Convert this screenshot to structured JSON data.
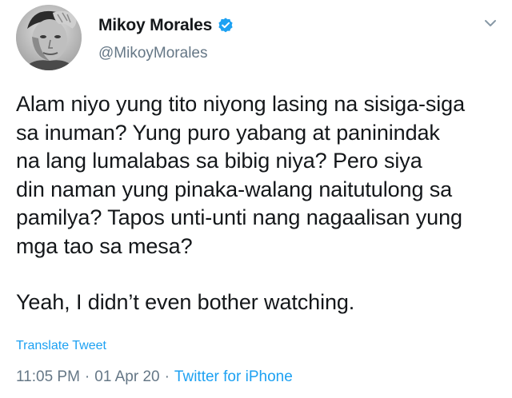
{
  "tweet": {
    "author": {
      "display_name": "Mikoy Morales",
      "handle": "@MikoyMorales",
      "verified": true,
      "avatar_icon": "profile-photo"
    },
    "menu_icon": "chevron-down-icon",
    "body": [
      "Alam niyo yung tito niyong lasing na sisiga-siga\nsa inuman? Yung puro yabang at paninindak\nna lang lumalabas sa bibig niya? Pero siya\ndin naman yung pinaka-walang naitutulong sa\npamilya? Tapos unti-unti nang nagaalisan yung\nmga tao sa mesa?",
      "Yeah, I didn’t even bother watching."
    ],
    "translate_label": "Translate Tweet",
    "time": "11:05 PM",
    "date": "01 Apr 20",
    "separator": "·",
    "source": "Twitter for iPhone"
  },
  "colors": {
    "text": "#14171a",
    "secondary": "#657786",
    "accent": "#1da1f2"
  }
}
